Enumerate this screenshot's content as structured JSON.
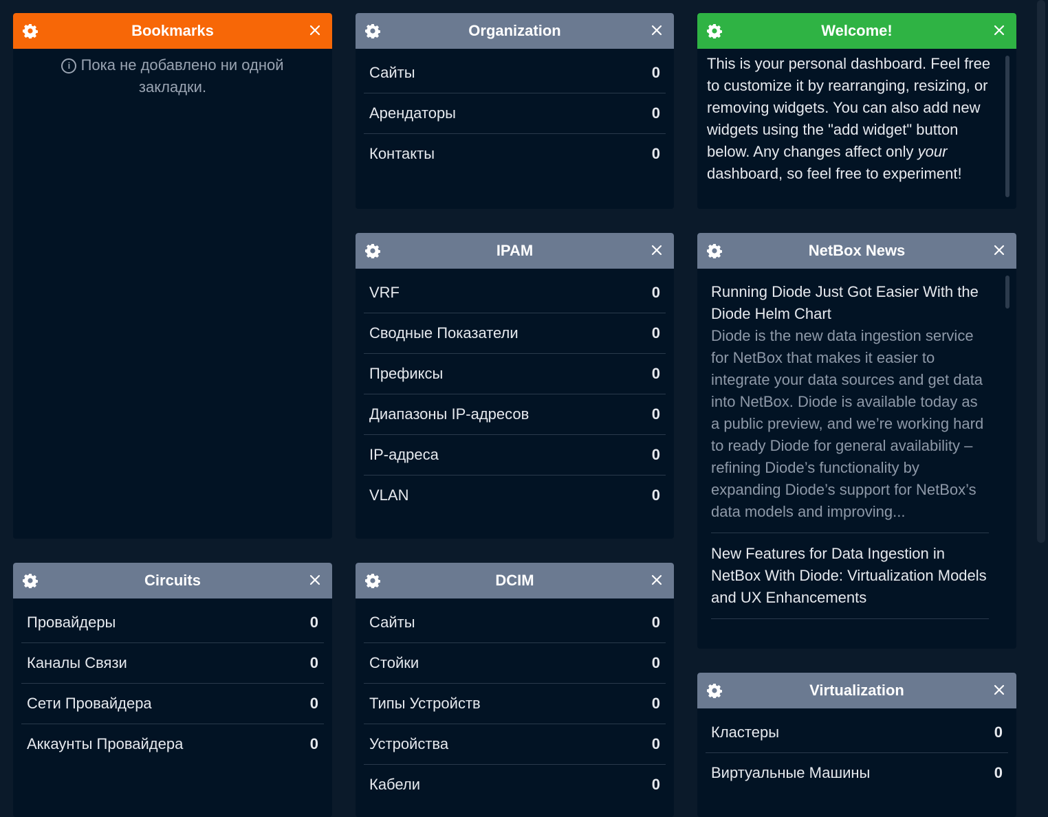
{
  "bookmarks": {
    "title": "Bookmarks",
    "empty_text": "Пока не добавлено ни одной закладки.",
    "color": "#f76707"
  },
  "organization": {
    "title": "Organization",
    "rows": [
      {
        "label": "Сайты",
        "count": "0"
      },
      {
        "label": "Арендаторы",
        "count": "0"
      },
      {
        "label": "Контакты",
        "count": "0"
      }
    ]
  },
  "welcome": {
    "title": "Welcome!",
    "color": "#2fb344",
    "text_before": "This is your personal dashboard. Feel free to customize it by rearranging, resizing, or removing widgets. You can also add new widgets using the \"add widget\" button below. Any changes affect only ",
    "text_em": "your",
    "text_after": " dashboard, so feel free to experiment!"
  },
  "ipam": {
    "title": "IPAM",
    "rows": [
      {
        "label": "VRF",
        "count": "0"
      },
      {
        "label": "Сводные Показатели",
        "count": "0"
      },
      {
        "label": "Префиксы",
        "count": "0"
      },
      {
        "label": "Диапазоны IP-адресов",
        "count": "0"
      },
      {
        "label": "IP-адреса",
        "count": "0"
      },
      {
        "label": "VLAN",
        "count": "0"
      }
    ]
  },
  "news": {
    "title": "NetBox News",
    "items": [
      {
        "title": "Running Diode Just Got Easier With the Diode Helm Chart",
        "text": "Diode is the new data ingestion service for NetBox that makes it easier to integrate your data sources and get data into NetBox.  Diode is available today as a public preview, and we’re working hard to ready Diode for general availability – refining Diode’s functionality by expanding Diode’s support for NetBox’s data models and improving..."
      },
      {
        "title": "New Features for Data Ingestion in NetBox With Diode: Virtualization Models and UX Enhancements",
        "text": ""
      }
    ]
  },
  "circuits": {
    "title": "Circuits",
    "rows": [
      {
        "label": "Провайдеры",
        "count": "0"
      },
      {
        "label": "Каналы Связи",
        "count": "0"
      },
      {
        "label": "Сети Провайдера",
        "count": "0"
      },
      {
        "label": "Аккаунты Провайдера",
        "count": "0"
      }
    ]
  },
  "dcim": {
    "title": "DCIM",
    "rows": [
      {
        "label": "Сайты",
        "count": "0"
      },
      {
        "label": "Стойки",
        "count": "0"
      },
      {
        "label": "Типы Устройств",
        "count": "0"
      },
      {
        "label": "Устройства",
        "count": "0"
      },
      {
        "label": "Кабели",
        "count": "0"
      }
    ]
  },
  "virtualization": {
    "title": "Virtualization",
    "rows": [
      {
        "label": "Кластеры",
        "count": "0"
      },
      {
        "label": "Виртуальные Машины",
        "count": "0"
      }
    ]
  },
  "theme": {
    "header_gray": "#6b7a91",
    "page_bg": "#0b1a2a",
    "widget_bg": "#021324"
  }
}
